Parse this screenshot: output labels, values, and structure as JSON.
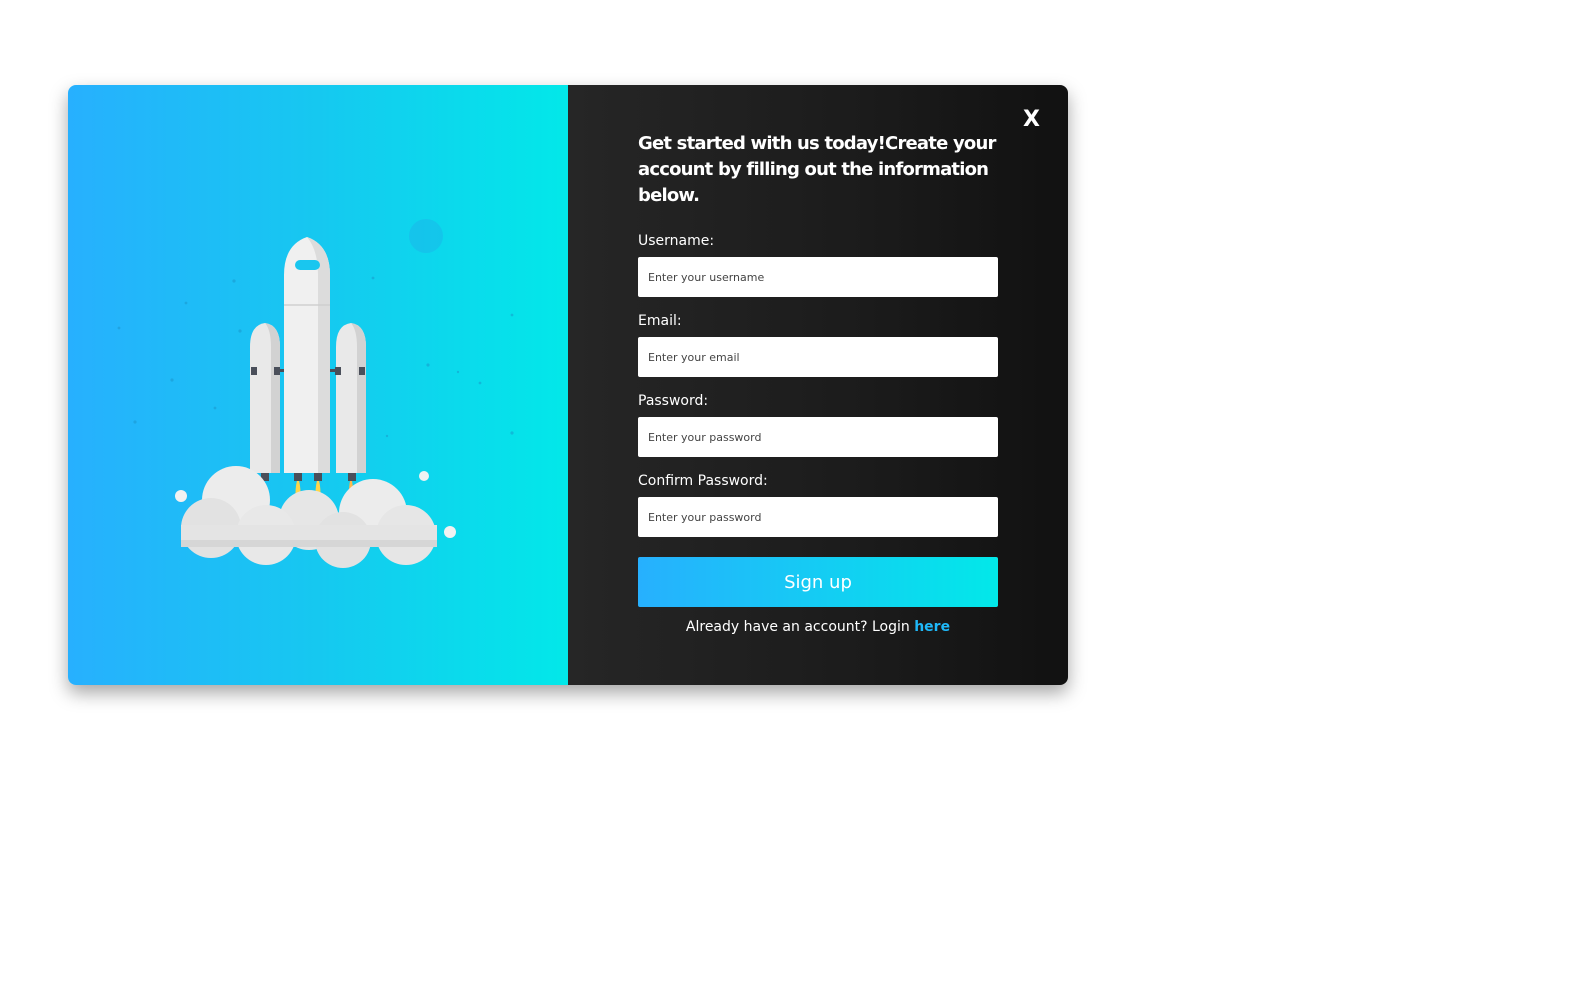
{
  "dialog": {
    "close_label": "X",
    "heading": "Get started with us today!Create your account by filling out the information below."
  },
  "form": {
    "username": {
      "label": "Username:",
      "placeholder": "Enter your username",
      "value": ""
    },
    "email": {
      "label": "Email:",
      "placeholder": "Enter your email",
      "value": ""
    },
    "password": {
      "label": "Password:",
      "placeholder": "Enter your password",
      "value": ""
    },
    "confirm_password": {
      "label": "Confirm Password:",
      "placeholder": "Enter your password",
      "value": ""
    },
    "submit_label": "Sign up"
  },
  "footer": {
    "prompt_text": "Already have an account? Login ",
    "link_text": "here"
  },
  "illustration": {
    "subject": "rocket-launch",
    "icon": "rocket-icon"
  },
  "colors": {
    "gradient_start": "#27b0fe",
    "gradient_end": "#02e8e9",
    "panel_dark": "#1b1b1b",
    "link": "#1fb8f8"
  }
}
